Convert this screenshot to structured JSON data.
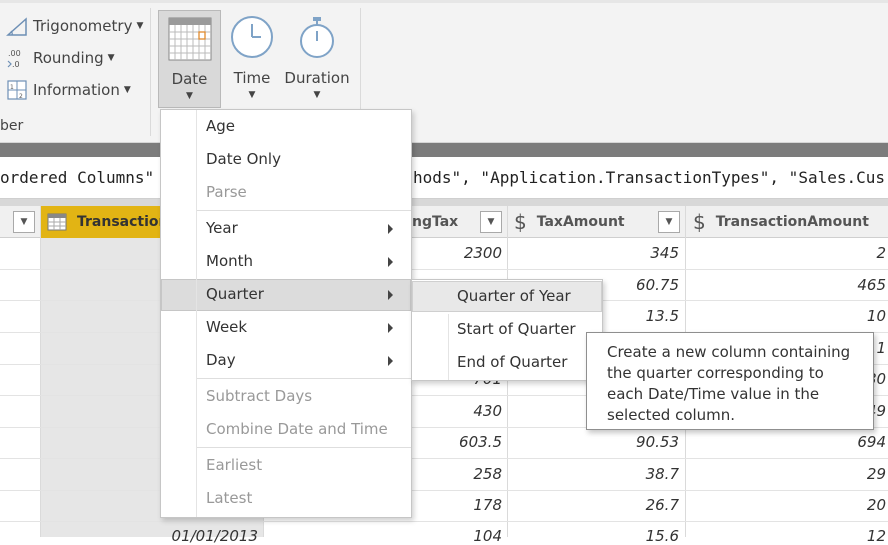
{
  "ribbon": {
    "trigonometry": "Trigonometry",
    "rounding": "Rounding",
    "information": "Information",
    "group_label": "ber",
    "date": "Date",
    "time": "Time",
    "duration": "Duration"
  },
  "formula": {
    "left_text": "ordered Columns\"",
    "right_text": "hods\", \"Application.TransactionTypes\", \"Sales.Cus"
  },
  "columns": {
    "transaction": "Transaction",
    "ingtax": "ngTax",
    "taxamount": "TaxAmount",
    "transactionamount": "TransactionAmount",
    "currency_symbol": "$"
  },
  "rows": [
    {
      "ingtax": "2300",
      "tax": "345",
      "amount": "2"
    },
    {
      "ingtax": "",
      "tax": "60.75",
      "amount": "465"
    },
    {
      "ingtax": "",
      "tax": "13.5",
      "amount": "10"
    },
    {
      "ingtax": "",
      "tax": "",
      "amount": "11"
    },
    {
      "ingtax": "701",
      "tax": "",
      "amount": "80"
    },
    {
      "ingtax": "430",
      "tax": "",
      "amount": "49"
    },
    {
      "ingtax": "603.5",
      "tax": "90.53",
      "amount": "694"
    },
    {
      "ingtax": "258",
      "tax": "38.7",
      "amount": "29"
    },
    {
      "ingtax": "178",
      "tax": "26.7",
      "amount": "20"
    },
    {
      "date": "01/01/2013",
      "ingtax": "104",
      "tax": "15.6",
      "amount": "12"
    }
  ],
  "menu": {
    "age": "Age",
    "date_only": "Date Only",
    "parse": "Parse",
    "year": "Year",
    "month": "Month",
    "quarter": "Quarter",
    "week": "Week",
    "day": "Day",
    "subtract_days": "Subtract Days",
    "combine": "Combine Date and Time",
    "earliest": "Earliest",
    "latest": "Latest"
  },
  "submenu": {
    "quarter_of_year": "Quarter of Year",
    "start_of_quarter": "Start of Quarter",
    "end_of_quarter": "End of Quarter"
  },
  "tooltip": {
    "text": "Create a new column containing the quarter corresponding to each Date/Time value in the selected column."
  },
  "colors": {
    "accent_header": "#e2b414",
    "menu_highlight": "#dcdcdc"
  }
}
